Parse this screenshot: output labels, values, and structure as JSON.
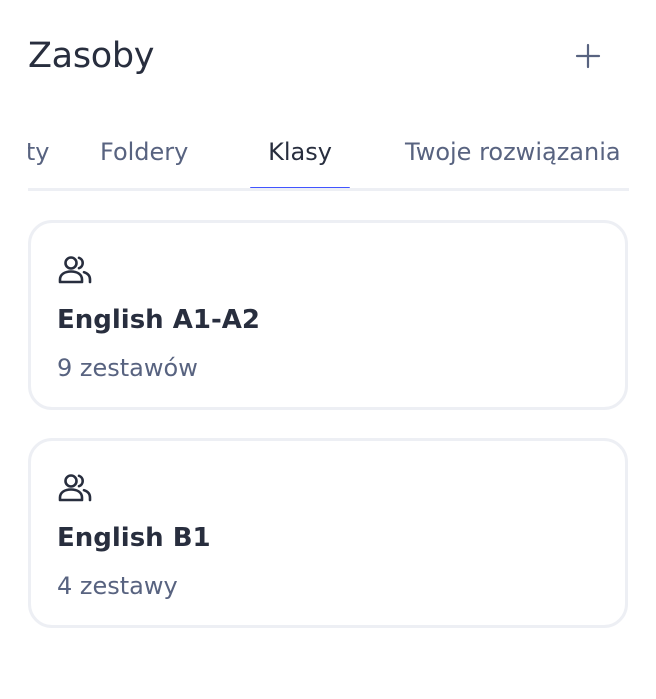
{
  "header": {
    "title": "Zasoby",
    "add_icon": "plus-icon"
  },
  "tabs": [
    {
      "label": "Testy",
      "active": false
    },
    {
      "label": "Foldery",
      "active": false
    },
    {
      "label": "Klasy",
      "active": true
    },
    {
      "label": "Twoje rozwiązania",
      "active": false
    }
  ],
  "classes": [
    {
      "icon": "users-icon",
      "name": "English A1-A2",
      "count_label": "9 zestawów"
    },
    {
      "icon": "users-icon",
      "name": "English B1",
      "count_label": "4 zestawy"
    }
  ],
  "colors": {
    "accent": "#4255ff",
    "text_primary": "#282e3e",
    "text_secondary": "#586380",
    "border": "#edeff4"
  }
}
